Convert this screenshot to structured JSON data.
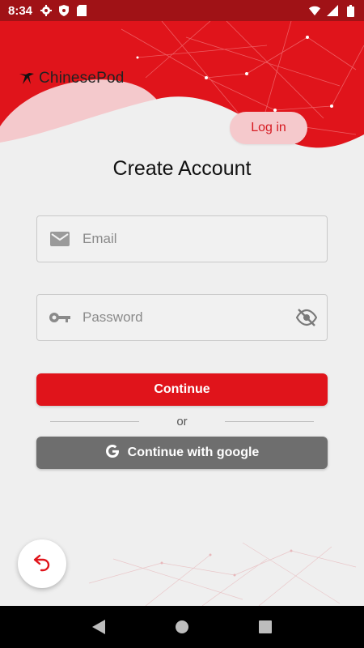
{
  "status_bar": {
    "time": "8:34",
    "icons_left": [
      "gear-icon",
      "shield-icon",
      "sd-card-icon"
    ],
    "icons_right": [
      "wifi-icon",
      "signal-icon",
      "battery-icon"
    ]
  },
  "app": {
    "logo_text": "ChinesePod",
    "login_label": "Log in",
    "title": "Create Account"
  },
  "form": {
    "email": {
      "placeholder": "Email",
      "value": "",
      "icon": "mail-icon"
    },
    "password": {
      "placeholder": "Password",
      "value": "",
      "icon": "key-icon",
      "trailing_icon": "visibility-off-icon"
    }
  },
  "actions": {
    "continue_label": "Continue",
    "divider_label": "or",
    "google_label": "Continue with google"
  },
  "navigation": {
    "buttons": [
      "back-triangle-icon",
      "home-circle-icon",
      "recents-square-icon"
    ]
  },
  "colors": {
    "brand_red": "#e0141b",
    "status_bar": "#a01216",
    "google_button": "#6e6e6e",
    "background": "#efefef"
  }
}
